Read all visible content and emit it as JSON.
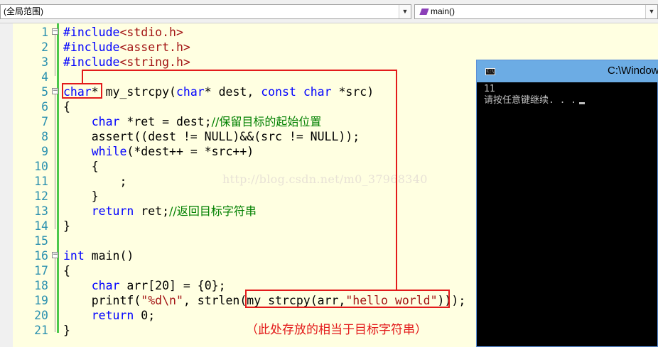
{
  "toolbar": {
    "scope_label": "(全局范围)",
    "function_label": "main()"
  },
  "code_lines": [
    {
      "n": "1",
      "parts": [
        {
          "t": "#include",
          "c": "pp"
        },
        {
          "t": "<stdio.h>",
          "c": "inc"
        }
      ]
    },
    {
      "n": "2",
      "parts": [
        {
          "t": "#include",
          "c": "pp"
        },
        {
          "t": "<assert.h>",
          "c": "inc"
        }
      ]
    },
    {
      "n": "3",
      "parts": [
        {
          "t": "#include",
          "c": "pp"
        },
        {
          "t": "<string.h>",
          "c": "inc"
        }
      ]
    },
    {
      "n": "4",
      "parts": []
    },
    {
      "n": "5",
      "parts": [
        {
          "t": "char",
          "c": "kw"
        },
        {
          "t": "* my_strcpy(",
          "c": ""
        },
        {
          "t": "char",
          "c": "kw"
        },
        {
          "t": "* dest, ",
          "c": ""
        },
        {
          "t": "const",
          "c": "kw"
        },
        {
          "t": " ",
          "c": ""
        },
        {
          "t": "char",
          "c": "kw"
        },
        {
          "t": " *src)",
          "c": ""
        }
      ]
    },
    {
      "n": "6",
      "parts": [
        {
          "t": "{",
          "c": ""
        }
      ]
    },
    {
      "n": "7",
      "parts": [
        {
          "t": "    ",
          "c": ""
        },
        {
          "t": "char",
          "c": "kw"
        },
        {
          "t": " *ret = dest;",
          "c": ""
        },
        {
          "t": "//保留目标的起始位置",
          "c": "cmt"
        }
      ]
    },
    {
      "n": "8",
      "parts": [
        {
          "t": "    assert((dest != NULL)&&(src != NULL));",
          "c": ""
        }
      ]
    },
    {
      "n": "9",
      "parts": [
        {
          "t": "    ",
          "c": ""
        },
        {
          "t": "while",
          "c": "kw"
        },
        {
          "t": "(*dest++ = *src++)",
          "c": ""
        }
      ]
    },
    {
      "n": "10",
      "parts": [
        {
          "t": "    {",
          "c": ""
        }
      ]
    },
    {
      "n": "11",
      "parts": [
        {
          "t": "        ;",
          "c": ""
        }
      ]
    },
    {
      "n": "12",
      "parts": [
        {
          "t": "    }",
          "c": ""
        }
      ]
    },
    {
      "n": "13",
      "parts": [
        {
          "t": "    ",
          "c": ""
        },
        {
          "t": "return",
          "c": "kw"
        },
        {
          "t": " ret;",
          "c": ""
        },
        {
          "t": "//返回目标字符串",
          "c": "cmt"
        }
      ]
    },
    {
      "n": "14",
      "parts": [
        {
          "t": "}",
          "c": ""
        }
      ]
    },
    {
      "n": "15",
      "parts": []
    },
    {
      "n": "16",
      "parts": [
        {
          "t": "int",
          "c": "kw"
        },
        {
          "t": " main()",
          "c": ""
        }
      ]
    },
    {
      "n": "17",
      "parts": [
        {
          "t": "{",
          "c": ""
        }
      ]
    },
    {
      "n": "18",
      "parts": [
        {
          "t": "    ",
          "c": ""
        },
        {
          "t": "char",
          "c": "kw"
        },
        {
          "t": " arr[20] = {0};",
          "c": ""
        }
      ]
    },
    {
      "n": "19",
      "parts": [
        {
          "t": "    printf(",
          "c": ""
        },
        {
          "t": "\"%d\\n\"",
          "c": "str"
        },
        {
          "t": ", strlen(my_strcpy(arr,",
          "c": ""
        },
        {
          "t": "\"hello world\"",
          "c": "str"
        },
        {
          "t": ")));",
          "c": ""
        }
      ]
    },
    {
      "n": "20",
      "parts": [
        {
          "t": "    ",
          "c": ""
        },
        {
          "t": "return",
          "c": "kw"
        },
        {
          "t": " 0;",
          "c": ""
        }
      ]
    },
    {
      "n": "21",
      "parts": [
        {
          "t": "}",
          "c": ""
        }
      ]
    }
  ],
  "watermark": "http://blog.csdn.net/m0_37968340",
  "annotation": "（此处存放的相当于目标字符串）",
  "console": {
    "title": "C:\\Windows",
    "output_line1": "11",
    "output_line2": "请按任意键继续. . ."
  }
}
